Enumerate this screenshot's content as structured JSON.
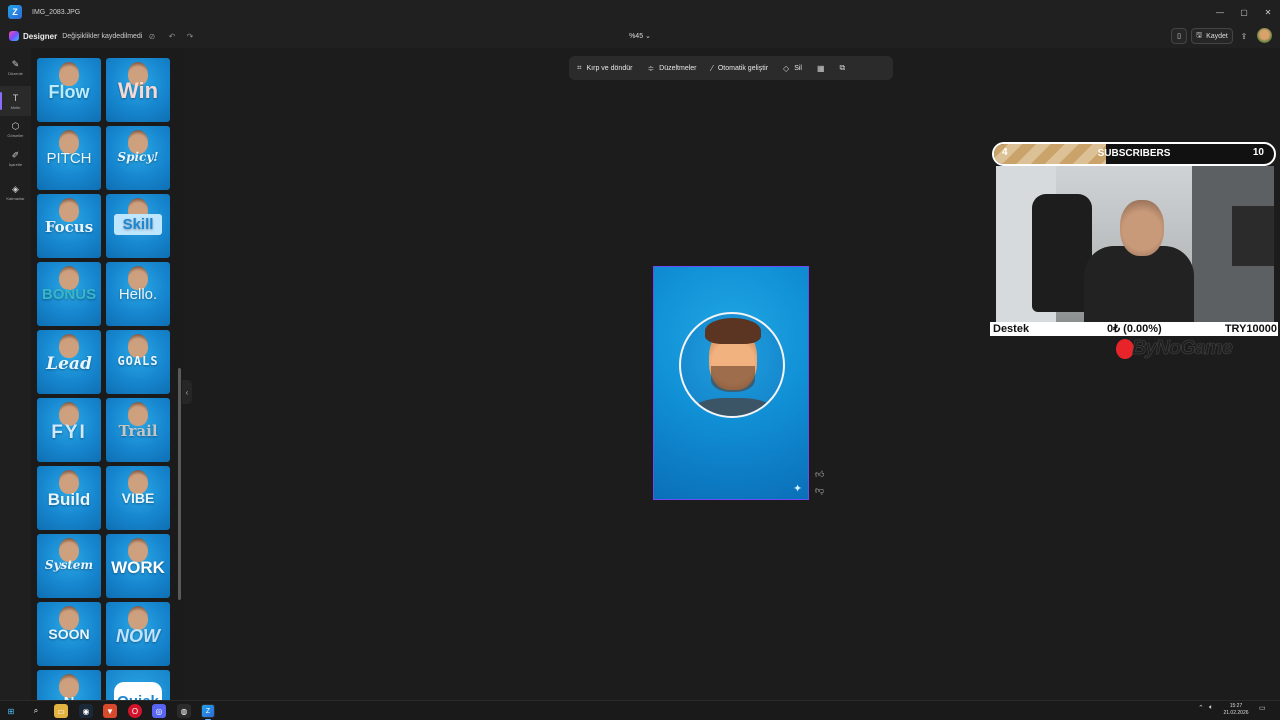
{
  "window": {
    "title": "IMG_2083.JPG",
    "controls": {
      "minimize": "—",
      "maximize": "▢",
      "close": "✕"
    }
  },
  "header": {
    "brand": "Designer",
    "save_status": "Değişiklikler kaydedilmedi",
    "zoom": "%45",
    "save_label": "Kaydet"
  },
  "rail": {
    "items": [
      {
        "label": "Düzenle",
        "icon": "✎"
      },
      {
        "label": "Metin",
        "icon": "T"
      },
      {
        "label": "Görseller",
        "icon": "⬡"
      },
      {
        "label": "İşaretle",
        "icon": "✐"
      },
      {
        "label": "Katmanlar",
        "icon": "◈"
      }
    ]
  },
  "panel": {
    "tiles": [
      {
        "text": "Flow"
      },
      {
        "text": "Win"
      },
      {
        "text": "PITCH"
      },
      {
        "text": "Spicy!"
      },
      {
        "text": "Focus"
      },
      {
        "text": "Skill"
      },
      {
        "text": "BONUS"
      },
      {
        "text": "Hello."
      },
      {
        "text": "Lead"
      },
      {
        "text": "GOALS"
      },
      {
        "text": "FYI"
      },
      {
        "text": "Trail"
      },
      {
        "text": "Build"
      },
      {
        "text": "VIBE"
      },
      {
        "text": "System"
      },
      {
        "text": "WORK"
      },
      {
        "text": "SOON"
      },
      {
        "text": "NOW"
      },
      {
        "text": "N"
      },
      {
        "text": "Quick"
      }
    ]
  },
  "toolbar": {
    "crop": "Kırp ve döndür",
    "adjust": "Düzeltmeler",
    "auto": "Otomatik geliştir",
    "erase": "Sil"
  },
  "overlay": {
    "sub_current": "4",
    "sub_label": "SUBSCRIBERS",
    "sub_goal": "10",
    "sub_progress": 0.4,
    "destek_label": "Destek",
    "destek_amount": "0₺ (0.00%)",
    "destek_goal": "TRY10000",
    "brand": "ByNoGame"
  },
  "taskbar": {
    "time": "15:27",
    "date": "21.02.2026"
  },
  "colors": {
    "accent": "#8b6cff",
    "canvas_border": "#6b4cf5",
    "art_blue": "#1190d6"
  }
}
